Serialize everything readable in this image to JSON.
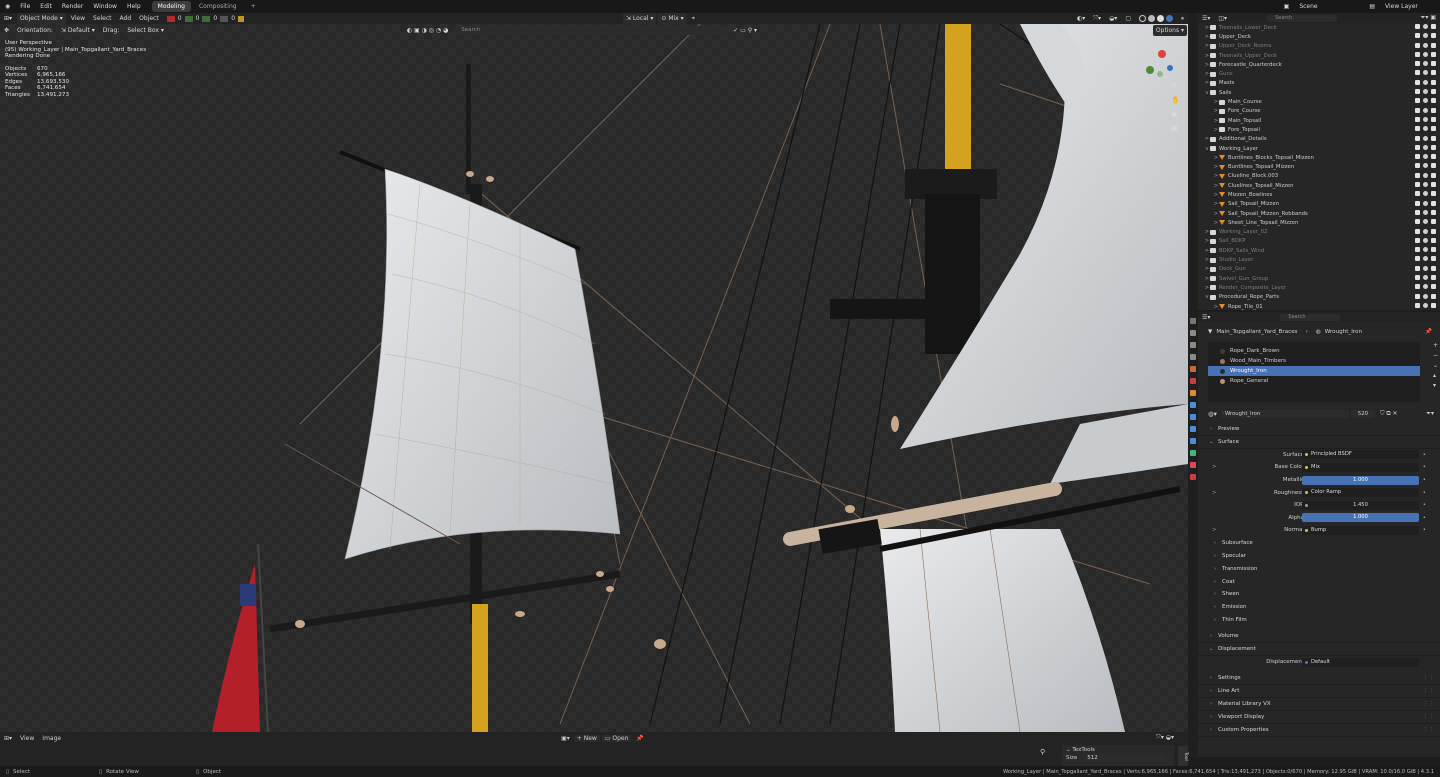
{
  "topbar": {
    "menus": [
      "File",
      "Edit",
      "Render",
      "Window",
      "Help"
    ],
    "tabs": [
      {
        "label": "Modeling",
        "active": true
      },
      {
        "label": "Compositing",
        "active": false
      }
    ],
    "scene": "Scene",
    "view_layer": "View Layer"
  },
  "viewport_header": {
    "mode": "Object Mode",
    "menus": [
      "View",
      "Select",
      "Add",
      "Object"
    ],
    "counters": [
      "0",
      "0",
      "0",
      "0"
    ],
    "transform_space": "Local",
    "pivot": "Mix",
    "orientation_label": "Orientation:",
    "orientation_value": "Default",
    "drag_label": "Drag:",
    "drag_value": "Select Box",
    "search_placeholder": "Search",
    "options_label": "Options"
  },
  "viewport_overlay": {
    "line1": "User Perspective",
    "line2": "(95) Working_Layer | Main_Topgallant_Yard_Braces",
    "line3": "Rendering Done",
    "stats": [
      {
        "label": "Objects",
        "value": "670"
      },
      {
        "label": "Vertices",
        "value": "6,965,166"
      },
      {
        "label": "Edges",
        "value": "13,693,530"
      },
      {
        "label": "Faces",
        "value": "6,741,654"
      },
      {
        "label": "Triangles",
        "value": "13,491,273"
      }
    ]
  },
  "outliner": {
    "search_placeholder": "Search",
    "rows": [
      {
        "label": "Treenails_Lower_Deck",
        "indent": 0,
        "kind": "coll",
        "dim": true,
        "chev": ">"
      },
      {
        "label": "Upper_Deck",
        "indent": 0,
        "kind": "coll",
        "dim": false,
        "chev": ">"
      },
      {
        "label": "Upper_Deck_Rooms",
        "indent": 0,
        "kind": "coll",
        "dim": true,
        "chev": ">"
      },
      {
        "label": "Treenails_Upper_Deck",
        "indent": 0,
        "kind": "coll",
        "dim": true,
        "chev": ">"
      },
      {
        "label": "Forecastle_Quarterdeck",
        "indent": 0,
        "kind": "coll",
        "dim": false,
        "chev": ">"
      },
      {
        "label": "Guns",
        "indent": 0,
        "kind": "coll",
        "dim": true,
        "chev": ">"
      },
      {
        "label": "Masts",
        "indent": 0,
        "kind": "coll",
        "dim": false,
        "chev": ">"
      },
      {
        "label": "Sails",
        "indent": 0,
        "kind": "coll",
        "dim": false,
        "chev": "v"
      },
      {
        "label": "Main_Course",
        "indent": 1,
        "kind": "coll",
        "dim": false,
        "chev": ">"
      },
      {
        "label": "Fore_Course",
        "indent": 1,
        "kind": "coll",
        "dim": false,
        "chev": ">"
      },
      {
        "label": "Main_Topsail",
        "indent": 1,
        "kind": "coll",
        "dim": false,
        "chev": ">"
      },
      {
        "label": "Fore_Topsail",
        "indent": 1,
        "kind": "coll",
        "dim": false,
        "chev": ">"
      },
      {
        "label": "Additional_Details",
        "indent": 0,
        "kind": "coll",
        "dim": false,
        "chev": ">"
      },
      {
        "label": "Working_Layer",
        "indent": 0,
        "kind": "coll",
        "dim": false,
        "chev": "v"
      },
      {
        "label": "Buntlines_Blocks_Topsail_Mizzen",
        "indent": 1,
        "kind": "obj",
        "dim": false,
        "chev": ">"
      },
      {
        "label": "Buntlines_Topsail_Mizzen",
        "indent": 1,
        "kind": "obj",
        "dim": false,
        "chev": ">"
      },
      {
        "label": "Clueline_Block.003",
        "indent": 1,
        "kind": "obj",
        "dim": false,
        "chev": ">"
      },
      {
        "label": "Cluelines_Topsail_Mizzen",
        "indent": 1,
        "kind": "obj",
        "dim": false,
        "chev": ">"
      },
      {
        "label": "Mizzen_Bowlines",
        "indent": 1,
        "kind": "obj",
        "dim": false,
        "chev": ">"
      },
      {
        "label": "Sail_Topsail_Mizzen",
        "indent": 1,
        "kind": "obj",
        "dim": false,
        "chev": ">"
      },
      {
        "label": "Sail_Topsail_Mizzen_Robbands",
        "indent": 1,
        "kind": "obj",
        "dim": false,
        "chev": ">"
      },
      {
        "label": "Sheet_Line_Topsail_Mizzen",
        "indent": 1,
        "kind": "obj",
        "dim": false,
        "chev": ">"
      },
      {
        "label": "Working_Layer_02",
        "indent": 0,
        "kind": "coll",
        "dim": true,
        "chev": ">"
      },
      {
        "label": "Sail_BDKP",
        "indent": 0,
        "kind": "coll",
        "dim": true,
        "chev": ">"
      },
      {
        "label": "BDKP_Sails_Wind",
        "indent": 0,
        "kind": "coll",
        "dim": true,
        "chev": ">"
      },
      {
        "label": "Studio_Layer",
        "indent": 0,
        "kind": "coll",
        "dim": true,
        "chev": ">"
      },
      {
        "label": "Deck_Gun",
        "indent": 0,
        "kind": "coll",
        "dim": true,
        "chev": ">"
      },
      {
        "label": "Swivel_Gun_Group",
        "indent": 0,
        "kind": "coll",
        "dim": true,
        "chev": ">"
      },
      {
        "label": "Render_Composite_Layer",
        "indent": 0,
        "kind": "coll",
        "dim": true,
        "chev": ">"
      },
      {
        "label": "Procedural_Rope_Parts",
        "indent": 0,
        "kind": "coll",
        "dim": false,
        "chev": "v"
      },
      {
        "label": "Rope_Tile_01",
        "indent": 1,
        "kind": "obj",
        "dim": false,
        "chev": ">"
      }
    ]
  },
  "properties": {
    "search_placeholder": "Search",
    "breadcrumb_object": "Main_Topgallant_Yard_Braces",
    "breadcrumb_material": "Wrought_Iron",
    "material_slots": [
      {
        "name": "Rope_Dark_Brown",
        "color": "#4a3a2c",
        "selected": false
      },
      {
        "name": "Wood_Main_Timbers",
        "color": "#a07a52",
        "selected": false
      },
      {
        "name": "Wrought_Iron",
        "color": "#2a2a2a",
        "selected": true
      },
      {
        "name": "Rope_General",
        "color": "#c09070",
        "selected": false
      }
    ],
    "material_name": "Wrought_Iron",
    "users_count": "520",
    "sections_top": [
      "Preview"
    ],
    "surface_label": "Surface",
    "fields": [
      {
        "label": "Surface",
        "value": "Principled BSDF",
        "kind": "socket",
        "chev": ""
      },
      {
        "label": "Base Color",
        "value": "Mix",
        "kind": "socket",
        "chev": ">"
      },
      {
        "label": "Metallic",
        "value": "1.000",
        "kind": "slider",
        "chev": ""
      },
      {
        "label": "Roughness",
        "value": "Color Ramp",
        "kind": "socket",
        "chev": ">"
      },
      {
        "label": "IOR",
        "value": "1.450",
        "kind": "num",
        "chev": ""
      },
      {
        "label": "Alpha",
        "value": "1.000",
        "kind": "slider",
        "chev": ""
      },
      {
        "label": "Normal",
        "value": "Bump",
        "kind": "socket",
        "chev": ">"
      }
    ],
    "sub_sections": [
      "Subsurface",
      "Specular",
      "Transmission",
      "Coat",
      "Sheen",
      "Emission",
      "Thin Film"
    ],
    "volume_label": "Volume",
    "displacement_label": "Displacement",
    "displacement_field_label": "Displacement",
    "displacement_value": "Default",
    "bottom_sections": [
      "Settings",
      "Line Art",
      "Material Library VX",
      "Viewport Display",
      "Custom Properties"
    ]
  },
  "image_editor": {
    "menus": [
      "View",
      "Image"
    ],
    "new_label": "New",
    "open_label": "Open",
    "panel_title": "TexTools",
    "size_label": "Size",
    "size_value": "512",
    "tab_label": "Tool"
  },
  "status_bar": {
    "select": "Select",
    "rotate": "Rotate View",
    "object": "Object",
    "info": "Working_Layer | Main_Topgallant_Yard_Braces | Verts:6,965,166 | Faces:6,741,654 | Tris:13,491,273 | Objects:0/670 | Memory: 12.95 GiB | VRAM: 10.0/16.0 GiB | 4.3.1"
  },
  "colors": {
    "accent": "#4772b3",
    "mast": "#d4a21e",
    "sail": "#e6e8ea",
    "flag": "#b4202a",
    "bg": "#2d2d2d"
  }
}
